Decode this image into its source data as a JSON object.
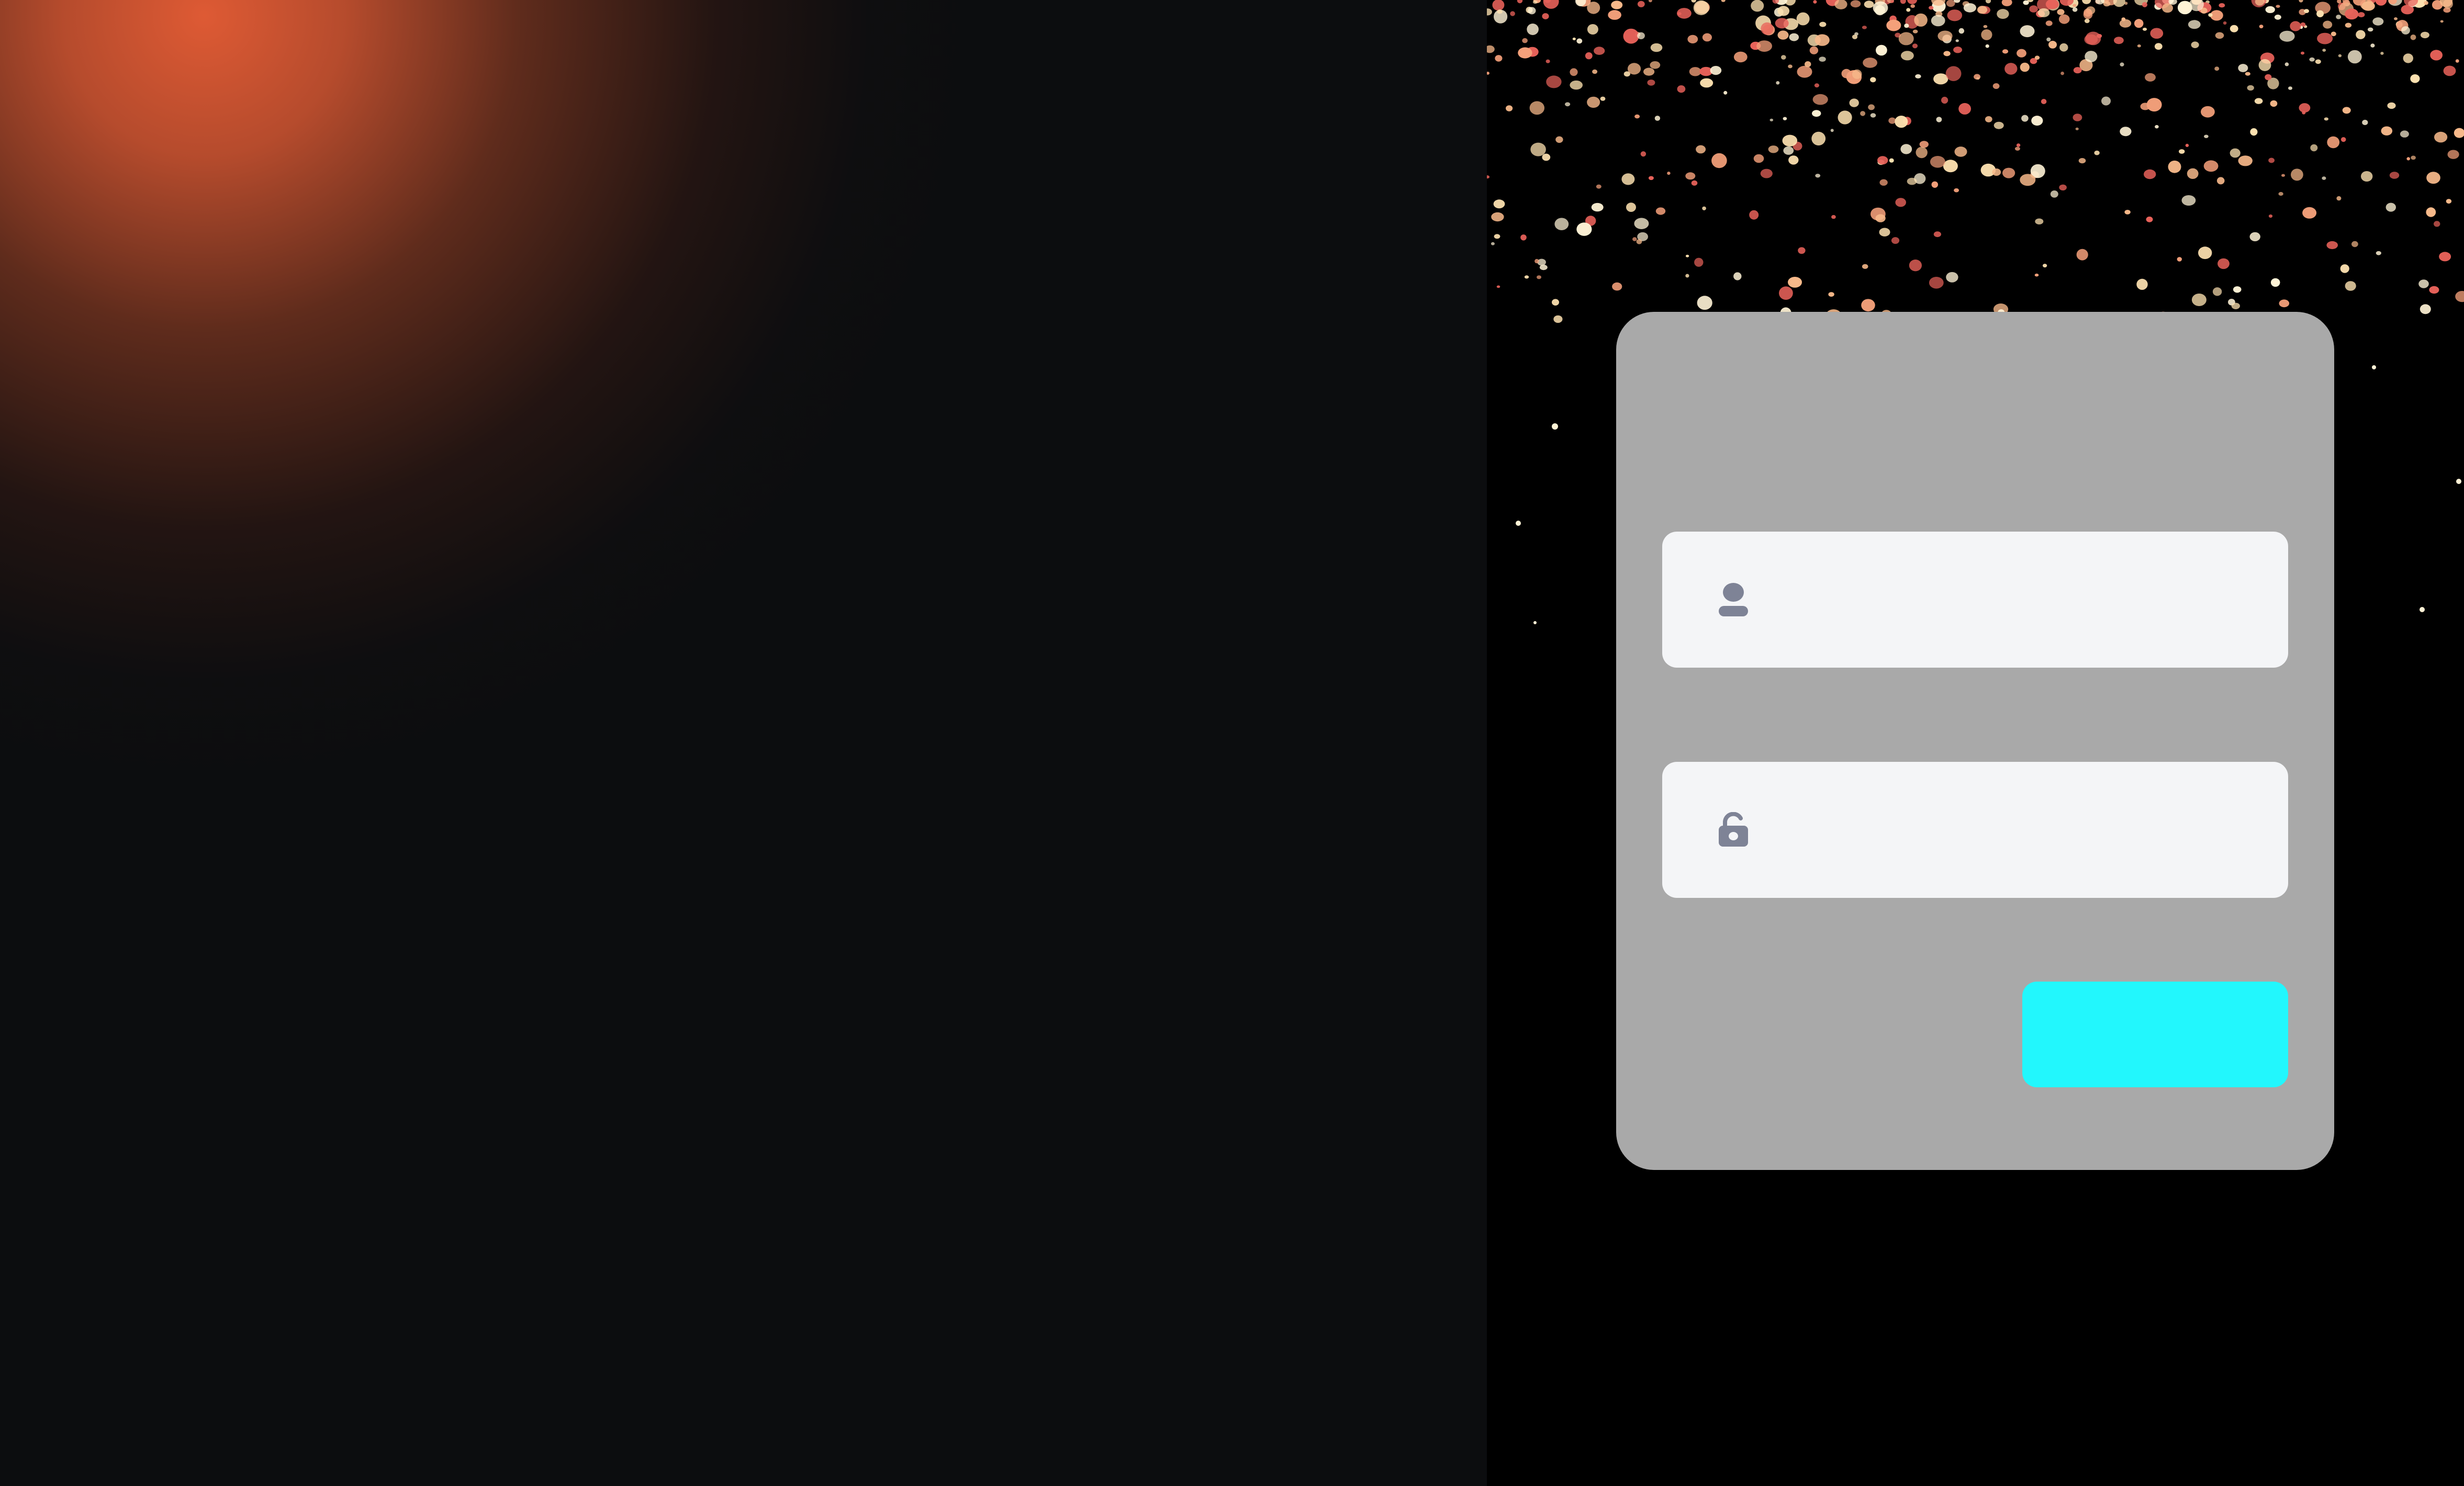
{
  "login": {
    "username": {
      "value": "",
      "placeholder": "",
      "icon": "user-icon"
    },
    "password": {
      "value": "",
      "placeholder": "",
      "icon": "lock-icon"
    },
    "submit_label": ""
  },
  "colors": {
    "left_glow": "#de5a34",
    "left_background": "#0c0d0f",
    "right_background": "#000000",
    "card_background": "#a9a9a9",
    "field_background": "#f4f5f7",
    "icon_color": "#7e8396",
    "button_color": "#22f7fd",
    "particle_colors": [
      "#f4a07a",
      "#fde1b0",
      "#e8625a",
      "#fff3d6",
      "#f7b98a"
    ]
  }
}
